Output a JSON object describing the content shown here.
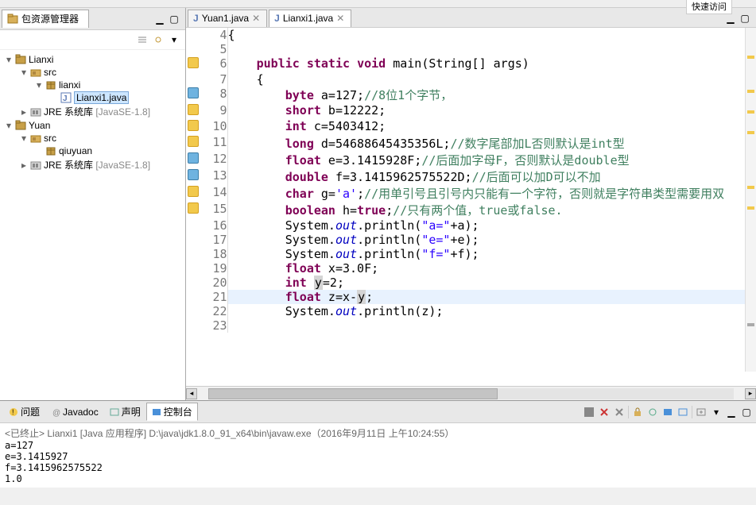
{
  "quick_access": "快速访问",
  "sidebar": {
    "title": "包资源管理器",
    "projects": [
      {
        "name": "Lianxi",
        "expanded": true,
        "children": [
          {
            "name": "src",
            "type": "srcfolder",
            "expanded": true,
            "children": [
              {
                "name": "lianxi",
                "type": "package",
                "expanded": true,
                "children": [
                  {
                    "name": "Lianxi1.java",
                    "type": "java",
                    "selected": true
                  }
                ]
              }
            ]
          },
          {
            "name": "JRE 系统库",
            "suffix": "[JavaSE-1.8]",
            "type": "jre"
          }
        ]
      },
      {
        "name": "Yuan",
        "expanded": true,
        "children": [
          {
            "name": "src",
            "type": "srcfolder",
            "expanded": true,
            "children": [
              {
                "name": "qiuyuan",
                "type": "package"
              }
            ]
          },
          {
            "name": "JRE 系统库",
            "suffix": "[JavaSE-1.8]",
            "type": "jre"
          }
        ]
      }
    ]
  },
  "editor": {
    "tabs": [
      {
        "label": "Yuan1.java",
        "active": false
      },
      {
        "label": "Lianxi1.java",
        "active": true
      }
    ],
    "lines": [
      {
        "n": 4,
        "indent": 0,
        "tokens": [
          [
            "",
            "{"
          ]
        ]
      },
      {
        "n": 5,
        "indent": 0,
        "tokens": []
      },
      {
        "n": 6,
        "mk": "warn",
        "indent": 1,
        "tokens": [
          [
            "kw",
            "public"
          ],
          [
            "",
            " "
          ],
          [
            "kw",
            "static"
          ],
          [
            "",
            " "
          ],
          [
            "kw",
            "void"
          ],
          [
            "",
            " main(String[] args)"
          ]
        ]
      },
      {
        "n": 7,
        "indent": 1,
        "tokens": [
          [
            "",
            "{"
          ]
        ]
      },
      {
        "n": 8,
        "mk": "info",
        "indent": 2,
        "tokens": [
          [
            "kw",
            "byte"
          ],
          [
            "",
            " a=127;"
          ],
          [
            "comment",
            "//8位1个字节，"
          ]
        ]
      },
      {
        "n": 9,
        "mk": "warn",
        "indent": 2,
        "tokens": [
          [
            "kw",
            "short"
          ],
          [
            "",
            " b=12222;"
          ]
        ]
      },
      {
        "n": 10,
        "mk": "warn",
        "indent": 2,
        "tokens": [
          [
            "kw",
            "int"
          ],
          [
            "",
            " c=5403412;"
          ]
        ]
      },
      {
        "n": 11,
        "mk": "warn",
        "indent": 2,
        "tokens": [
          [
            "kw",
            "long"
          ],
          [
            "",
            " d=54688645435356L;"
          ],
          [
            "comment",
            "//数字尾部加L否则默认是int型"
          ]
        ]
      },
      {
        "n": 12,
        "mk": "info",
        "indent": 2,
        "tokens": [
          [
            "kw",
            "float"
          ],
          [
            "",
            " e=3.1415928F;"
          ],
          [
            "comment",
            "//后面加字母F，否则默认是double型"
          ]
        ]
      },
      {
        "n": 13,
        "mk": "info",
        "indent": 2,
        "tokens": [
          [
            "kw",
            "double"
          ],
          [
            "",
            " f=3.1415962575522D;"
          ],
          [
            "comment",
            "//后面可以加D可以不加"
          ]
        ]
      },
      {
        "n": 14,
        "mk": "warn",
        "indent": 2,
        "tokens": [
          [
            "kw",
            "char"
          ],
          [
            "",
            " g="
          ],
          [
            "char",
            "'a'"
          ],
          [
            "",
            ";"
          ],
          [
            "comment",
            "//用单引号且引号内只能有一个字符，否则就是字符串类型需要用双"
          ]
        ]
      },
      {
        "n": 15,
        "mk": "warn",
        "indent": 2,
        "tokens": [
          [
            "kw",
            "boolean"
          ],
          [
            "",
            " h="
          ],
          [
            "kw",
            "true"
          ],
          [
            "",
            ";"
          ],
          [
            "comment",
            "//只有两个值，true或false."
          ]
        ]
      },
      {
        "n": 16,
        "indent": 2,
        "tokens": [
          [
            "",
            "System."
          ],
          [
            "field",
            "out"
          ],
          [
            "",
            ".println("
          ],
          [
            "str",
            "\"a=\""
          ],
          [
            "",
            "+a);"
          ]
        ]
      },
      {
        "n": 17,
        "indent": 2,
        "tokens": [
          [
            "",
            "System."
          ],
          [
            "field",
            "out"
          ],
          [
            "",
            ".println("
          ],
          [
            "str",
            "\"e=\""
          ],
          [
            "",
            "+e);"
          ]
        ]
      },
      {
        "n": 18,
        "indent": 2,
        "tokens": [
          [
            "",
            "System."
          ],
          [
            "field",
            "out"
          ],
          [
            "",
            ".println("
          ],
          [
            "str",
            "\"f=\""
          ],
          [
            "",
            "+f);"
          ]
        ]
      },
      {
        "n": 19,
        "indent": 2,
        "tokens": [
          [
            "kw",
            "float"
          ],
          [
            "",
            " x=3.0F;"
          ]
        ]
      },
      {
        "n": 20,
        "indent": 2,
        "tokens": [
          [
            "kw",
            "int"
          ],
          [
            "",
            " "
          ],
          [
            "caret",
            "y"
          ],
          [
            "",
            "=2;"
          ]
        ]
      },
      {
        "n": 21,
        "hl": true,
        "indent": 2,
        "tokens": [
          [
            "kw",
            "float"
          ],
          [
            "",
            " z=x-"
          ],
          [
            "caret",
            "y"
          ],
          [
            "",
            ";"
          ]
        ]
      },
      {
        "n": 22,
        "indent": 2,
        "tokens": [
          [
            "",
            "System."
          ],
          [
            "field",
            "out"
          ],
          [
            "",
            ".println(z);"
          ]
        ]
      },
      {
        "n": 23,
        "indent": 0,
        "tokens": []
      }
    ]
  },
  "console": {
    "tabs": [
      {
        "label": "问题",
        "icon": "problems-icon"
      },
      {
        "label": "Javadoc",
        "icon": "javadoc-icon"
      },
      {
        "label": "声明",
        "icon": "declaration-icon"
      },
      {
        "label": "控制台",
        "icon": "console-icon",
        "active": true
      }
    ],
    "header": "<已终止> Lianxi1 [Java 应用程序] D:\\java\\jdk1.8.0_91_x64\\bin\\javaw.exe（2016年9月11日 上午10:24:55）",
    "output": [
      "a=127",
      "e=3.1415927",
      "f=3.1415962575522",
      "1.0"
    ]
  }
}
